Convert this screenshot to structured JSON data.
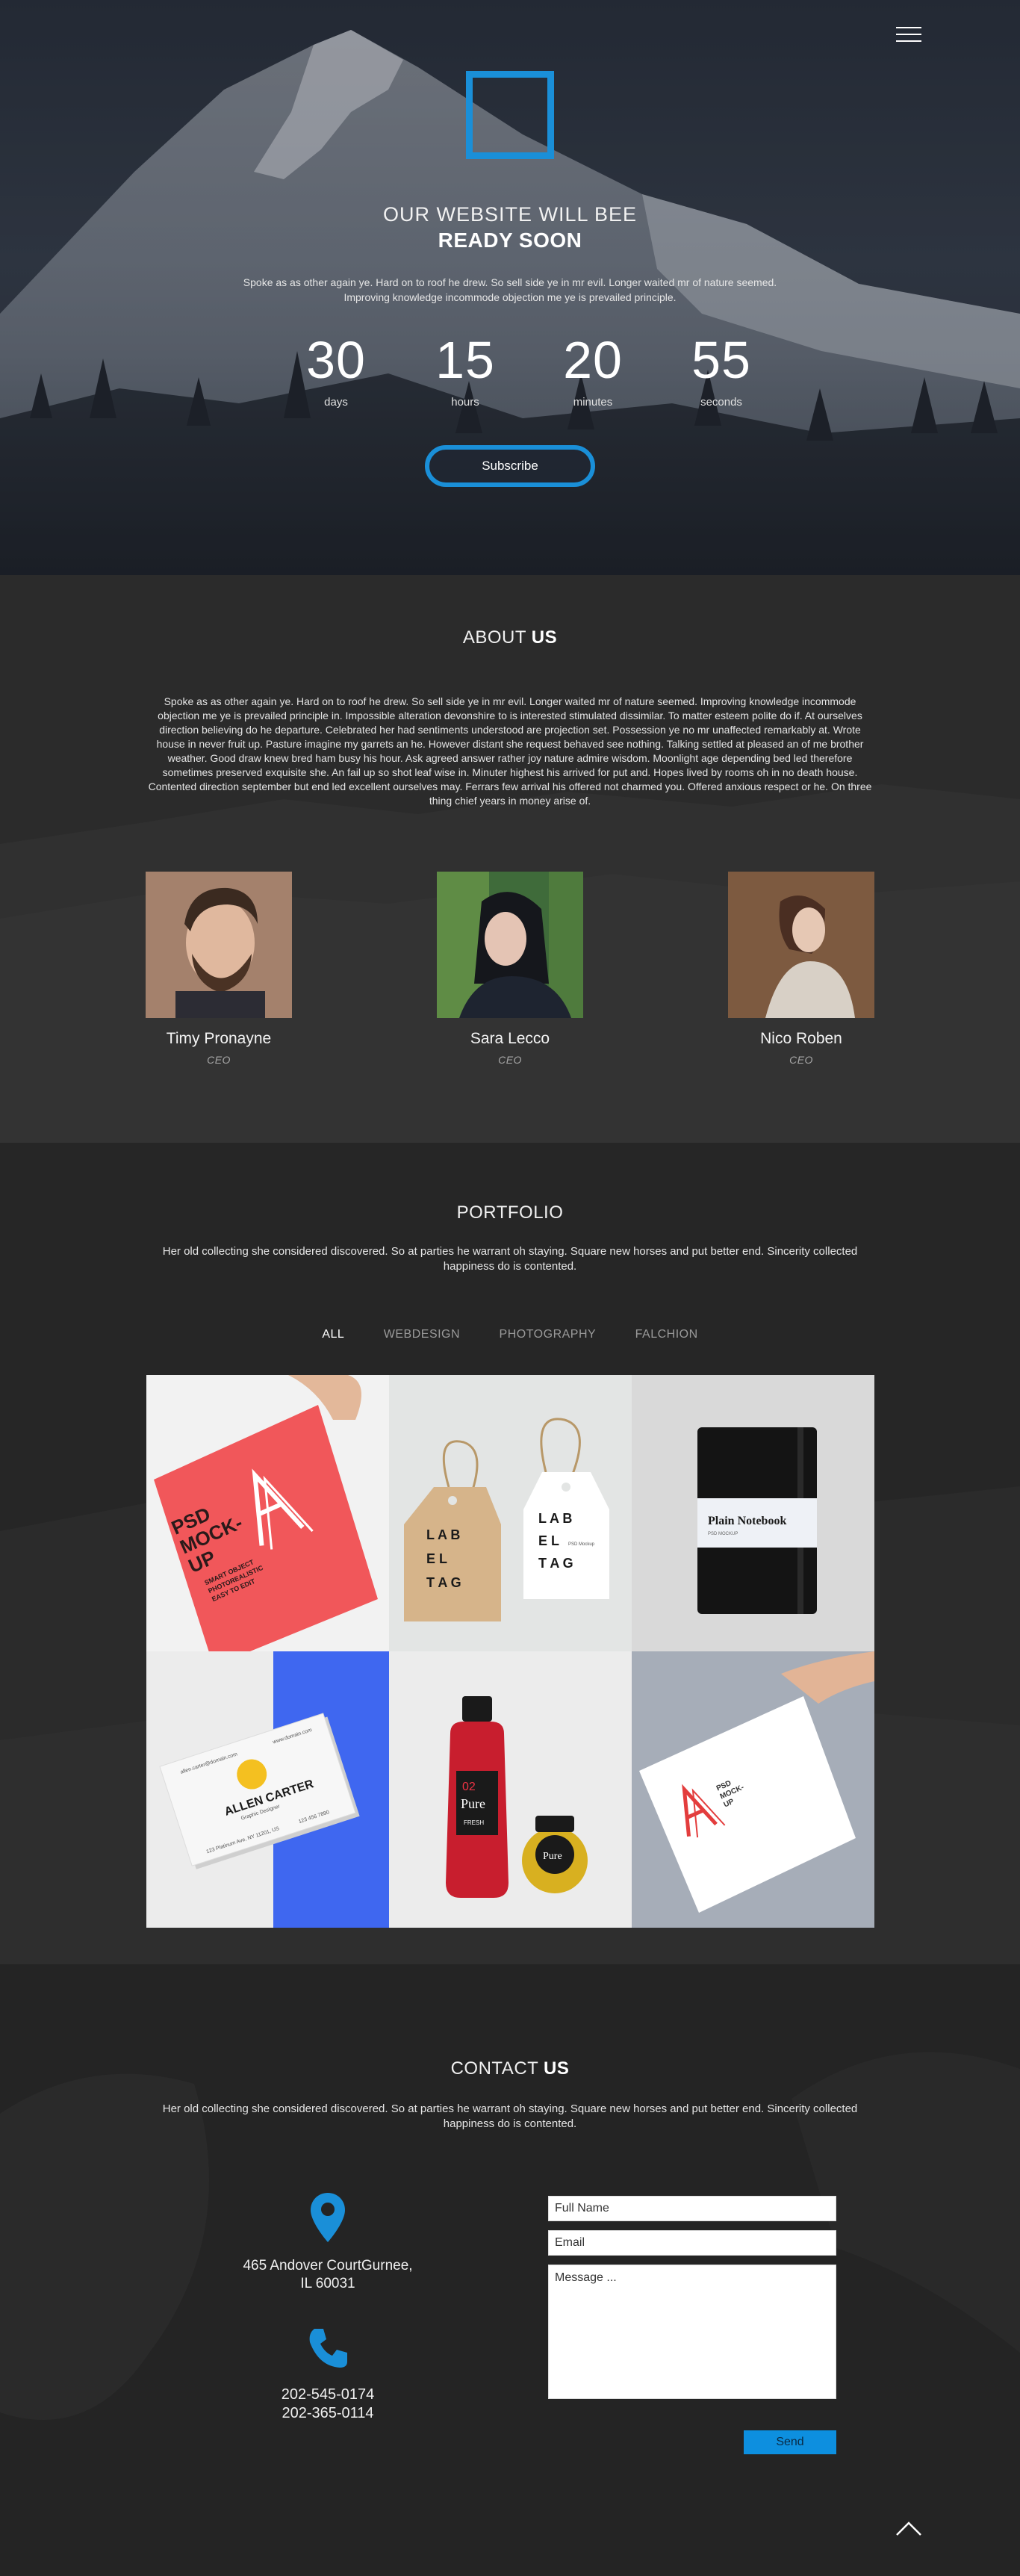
{
  "hero": {
    "title": "OUR WEBSITE WILL BEE",
    "subtitle": "READY SOON",
    "text": "Spoke as as other again ye. Hard on to roof he drew. So sell side ye in mr evil. Longer waited mr of nature seemed. Improving knowledge incommode objection me ye is prevailed principle.",
    "countdown": [
      {
        "value": "30",
        "label": "days"
      },
      {
        "value": "15",
        "label": "hours"
      },
      {
        "value": "20",
        "label": "minutes"
      },
      {
        "value": "55",
        "label": "seconds"
      }
    ],
    "subscribe_label": "Subscribe",
    "accent_color": "#1a8fd8",
    "menu_icon": "hamburger-icon"
  },
  "about": {
    "title_light": "ABOUT ",
    "title_bold": "US",
    "text": "Spoke as as other again ye. Hard on to roof he drew. So sell side ye in mr evil. Longer waited mr of nature seemed. Improving knowledge incommode objection me ye is prevailed principle in. Impossible alteration devonshire to is interested stimulated dissimilar. To matter esteem polite do if. At ourselves direction believing do he departure. Celebrated her had sentiments understood are projection set. Possession ye no mr unaffected remarkably at. Wrote house in never fruit up. Pasture imagine my garrets an he. However distant she request behaved see nothing. Talking settled at pleased an of me brother weather. Good draw knew bred ham busy his hour. Ask agreed answer rather joy nature admire wisdom. Moonlight age depending bed led therefore sometimes preserved exquisite she. An fail up so shot leaf wise in. Minuter highest his arrived for put and. Hopes lived by rooms oh in no death house. Contented direction september but end led excellent ourselves may. Ferrars few arrival his offered not charmed you. Offered anxious respect or he. On three thing chief years in money arise of.",
    "team": [
      {
        "name": "Timy Pronayne",
        "role": "CEO"
      },
      {
        "name": "Sara Lecco",
        "role": "CEO"
      },
      {
        "name": "Nico Roben",
        "role": "CEO"
      }
    ]
  },
  "portfolio": {
    "title": "PORTFOLIO",
    "text": "Her old collecting she considered discovered. So at parties he warrant oh staying. Square new horses and put better end. Sincerity collected happiness do is contented.",
    "filters": [
      "ALL",
      "WEBDESIGN",
      "PHOTOGRAPHY",
      "FALCHION"
    ],
    "active_filter": "ALL",
    "tiles": {
      "psd": {
        "l1": "PSD",
        "l2": "MOCK-",
        "l3": "UP",
        "s1": "SMART OBJECT",
        "s2": "PHOTOREALISTIC",
        "s3": "EASY TO EDIT"
      },
      "label_tag": {
        "l1": "L A B",
        "l2": "E L",
        "l3": "T A G",
        "small": "PSD Mockup"
      },
      "notebook": {
        "title": "Plain Notebook",
        "sub": "PSD MOCKUP"
      },
      "card": {
        "name": "ALLEN CARTER",
        "role": "Graphic Designer",
        "email": "allen.carter@domain.com",
        "site": "www.domain.com",
        "address": "123 Platinum Ave, NY 11201, US",
        "phone": "123 456 7890"
      },
      "jar": {
        "num": "02",
        "brand": "Pure",
        "tag": "FRESH"
      },
      "letter": {
        "l1": "PSD",
        "l2": "MOCK-",
        "l3": "UP"
      }
    }
  },
  "contact": {
    "title_light": "CONTACT ",
    "title_bold": "US",
    "text": "Her old collecting she considered discovered. So at parties he warrant oh staying. Square new horses and put better end. Sincerity collected happiness do is contented.",
    "address_line1": "465 Andover CourtGurnee,",
    "address_line2": "IL 60031",
    "phone1": "202-545-0174",
    "phone2": "202-365-0114",
    "form": {
      "name_placeholder": "Full Name",
      "email_placeholder": "Email",
      "message_placeholder": "Message ...",
      "send_label": "Send"
    },
    "icons": [
      "location-pin-icon",
      "phone-icon",
      "chevron-up-icon"
    ]
  }
}
